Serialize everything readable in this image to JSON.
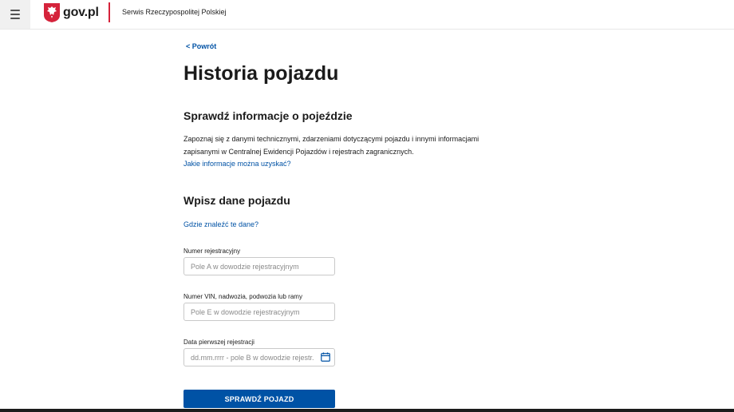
{
  "header": {
    "logo_text": "gov.pl",
    "service_name": "Serwis Rzeczypospolitej Polskiej"
  },
  "main": {
    "back_label": "< Powrót",
    "page_title": "Historia pojazdu",
    "section1": {
      "title": "Sprawdź informacje o pojeździe",
      "description": "Zapoznaj się z danymi technicznymi, zdarzeniami dotyczącymi pojazdu i innymi informacjami zapisanymi w Centralnej Ewidencji Pojazdów i rejestrach zagranicznych.",
      "link": "Jakie informacje można uzyskać?"
    },
    "section2": {
      "title": "Wpisz dane pojazdu",
      "link": "Gdzie znaleźć te dane?"
    },
    "form": {
      "registration_label": "Numer rejestracyjny",
      "registration_placeholder": "Pole A w dowodzie rejestracyjnym",
      "vin_label": "Numer VIN, nadwozia, podwozia lub ramy",
      "vin_placeholder": "Pole E w dowodzie rejestracyjnym",
      "date_label": "Data pierwszej rejestracji",
      "date_placeholder": "dd.mm.rrrr - pole B w dowodzie rejestr.",
      "submit_label": "SPRAWDŹ POJAZD"
    }
  },
  "colors": {
    "accent": "#0052a5",
    "divider": "#d5233b"
  }
}
